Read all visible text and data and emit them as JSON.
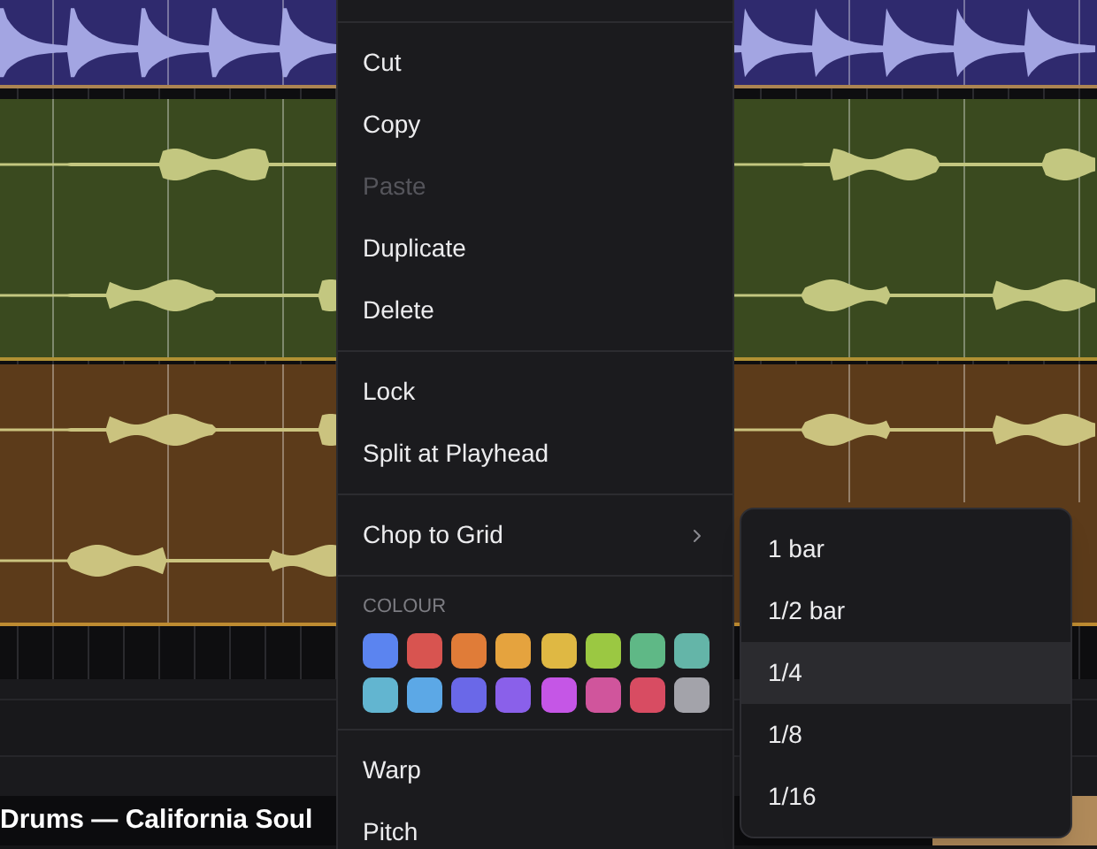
{
  "tracks": [
    {
      "kind": "hits",
      "color": "#2f2a6e"
    },
    {
      "kind": "tone",
      "color": "#3a4a1f"
    },
    {
      "kind": "tone",
      "color": "#5c3b1a"
    }
  ],
  "footer": {
    "clip_title": "Drums — California Soul"
  },
  "context_menu": {
    "groups": [
      {
        "kind": "actions",
        "items": [
          {
            "label": "Cut",
            "disabled": false,
            "has_submenu": false
          },
          {
            "label": "Copy",
            "disabled": false,
            "has_submenu": false
          },
          {
            "label": "Paste",
            "disabled": true,
            "has_submenu": false
          },
          {
            "label": "Duplicate",
            "disabled": false,
            "has_submenu": false
          },
          {
            "label": "Delete",
            "disabled": false,
            "has_submenu": false
          }
        ]
      },
      {
        "kind": "actions",
        "items": [
          {
            "label": "Lock",
            "disabled": false,
            "has_submenu": false
          },
          {
            "label": "Split at Playhead",
            "disabled": false,
            "has_submenu": false
          }
        ]
      },
      {
        "kind": "actions",
        "items": [
          {
            "label": "Chop to Grid",
            "disabled": false,
            "has_submenu": true
          }
        ]
      },
      {
        "kind": "colours",
        "label": "COLOUR",
        "swatches": [
          {
            "color": "#5b84f0"
          },
          {
            "color": "#d85450"
          },
          {
            "color": "#e07c38"
          },
          {
            "color": "#e5a33e"
          },
          {
            "color": "#dfb843"
          },
          {
            "color": "#9bc842"
          },
          {
            "color": "#5fb886"
          },
          {
            "color": "#64b5a8"
          },
          {
            "color": "#62b5d0"
          },
          {
            "color": "#5ca8e6"
          },
          {
            "color": "#6a68e8"
          },
          {
            "color": "#8a60ea"
          },
          {
            "color": "#c556e6"
          },
          {
            "color": "#d0559c"
          },
          {
            "color": "#d84c62"
          },
          {
            "color": "#a3a3aa"
          }
        ]
      },
      {
        "kind": "actions",
        "items": [
          {
            "label": "Warp",
            "disabled": false,
            "has_submenu": false
          },
          {
            "label": "Pitch",
            "disabled": false,
            "has_submenu": false
          }
        ]
      }
    ]
  },
  "submenu": {
    "items": [
      {
        "label": "1 bar",
        "selected": false
      },
      {
        "label": "1/2 bar",
        "selected": false
      },
      {
        "label": "1/4",
        "selected": true
      },
      {
        "label": "1/8",
        "selected": false
      },
      {
        "label": "1/16",
        "selected": false
      }
    ]
  }
}
